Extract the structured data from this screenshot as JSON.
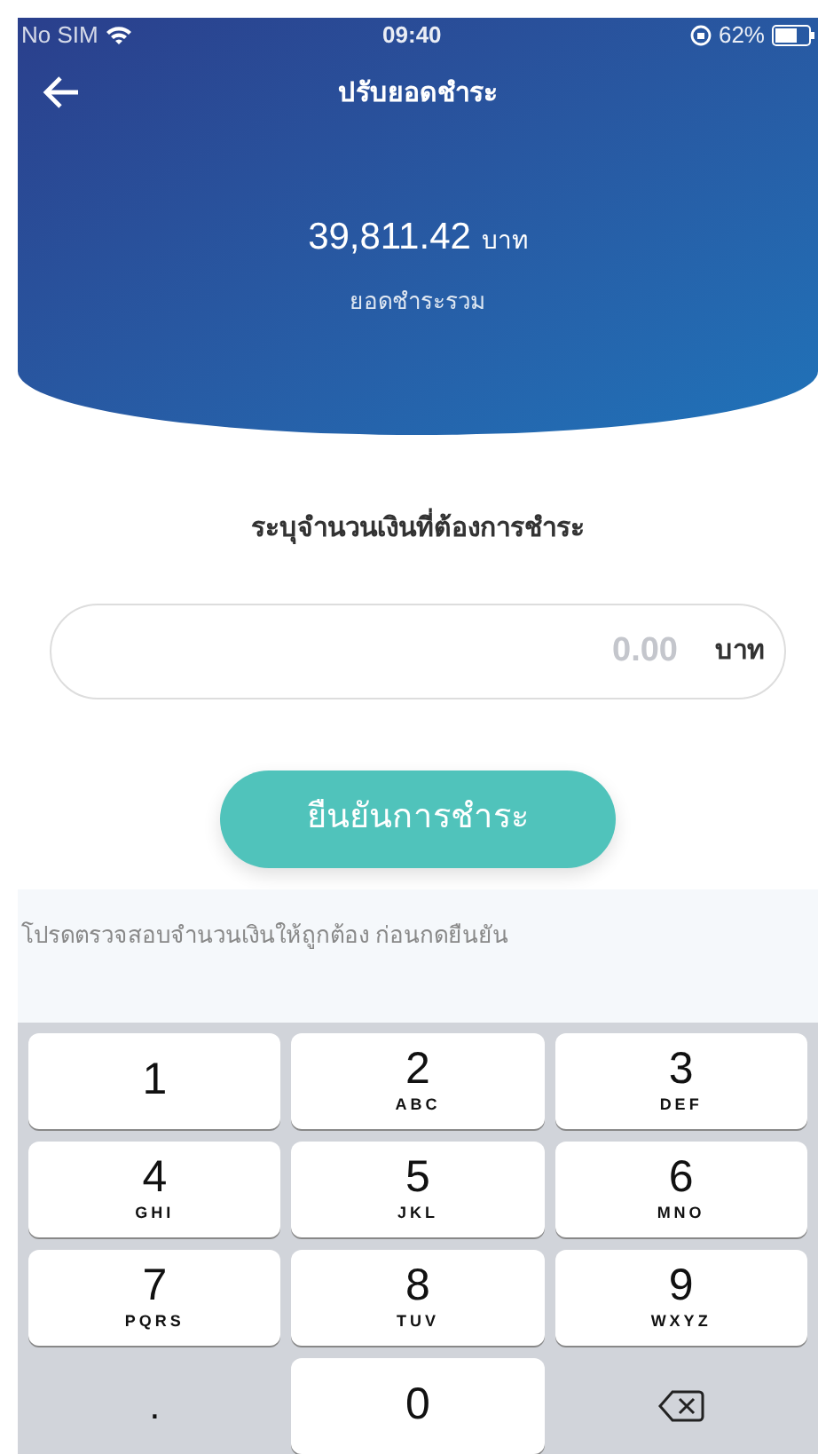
{
  "status_bar": {
    "carrier": "No SIM",
    "time": "09:40",
    "battery": "62%"
  },
  "header": {
    "title": "ปรับยอดชำระ",
    "amount": "39,811.42",
    "amount_unit": "บาท",
    "amount_label": "ยอดชำระรวม"
  },
  "prompt": "ระบุจำนวนเงินที่ต้องการชำระ",
  "amount_field": {
    "placeholder": "0.00",
    "unit": "บาท"
  },
  "confirm_button": "ยืนยันการชำระ",
  "hint": "โปรดตรวจสอบจำนวนเงินให้ถูกต้อง ก่อนกดยืนยัน",
  "keypad": [
    {
      "kind": "digit",
      "digit": "1"
    },
    {
      "kind": "digit",
      "digit": "2",
      "letters": "ABC"
    },
    {
      "kind": "digit",
      "digit": "3",
      "letters": "DEF"
    },
    {
      "kind": "digit",
      "digit": "4",
      "letters": "GHI"
    },
    {
      "kind": "digit",
      "digit": "5",
      "letters": "JKL"
    },
    {
      "kind": "digit",
      "digit": "6",
      "letters": "MNO"
    },
    {
      "kind": "digit",
      "digit": "7",
      "letters": "PQRS"
    },
    {
      "kind": "digit",
      "digit": "8",
      "letters": "TUV"
    },
    {
      "kind": "digit",
      "digit": "9",
      "letters": "WXYZ"
    },
    {
      "kind": "symbol",
      "digit": "."
    },
    {
      "kind": "digit",
      "digit": "0"
    },
    {
      "kind": "delete"
    }
  ]
}
